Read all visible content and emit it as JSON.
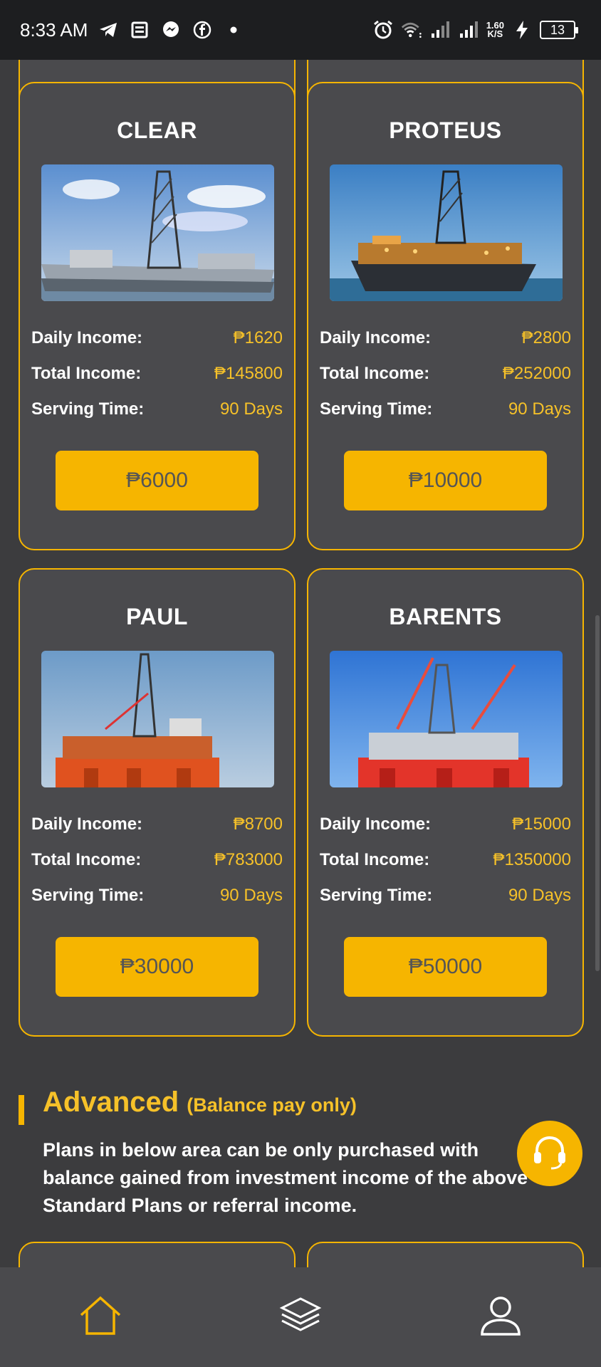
{
  "status_bar": {
    "time": "8:33 AM",
    "net_speed_value": "1.60",
    "net_speed_unit": "K/S",
    "battery": "13",
    "icons": [
      "telegram-icon",
      "news-icon",
      "messenger-icon",
      "facebook-icon",
      "dot-icon",
      "alarm-icon",
      "wifi-icon",
      "signal-icon",
      "signal-icon",
      "charging-icon"
    ]
  },
  "labels": {
    "daily_income": "Daily Income:",
    "total_income": "Total Income:",
    "serving_time": "Serving Time:"
  },
  "plans": [
    {
      "name": "CLEAR",
      "daily": "₱1620",
      "total": "₱145800",
      "time": "90 Days",
      "price": "₱6000"
    },
    {
      "name": "PROTEUS",
      "daily": "₱2800",
      "total": "₱252000",
      "time": "90 Days",
      "price": "₱10000"
    },
    {
      "name": "PAUL",
      "daily": "₱8700",
      "total": "₱783000",
      "time": "90 Days",
      "price": "₱30000"
    },
    {
      "name": "BARENTS",
      "daily": "₱15000",
      "total": "₱1350000",
      "time": "90 Days",
      "price": "₱50000"
    }
  ],
  "advanced": {
    "title": "Advanced",
    "subtitle": "(Balance pay only)",
    "description": "Plans in below area can be only purchased with balance gained from investment income of the above Standard Plans or referral income."
  },
  "bottom_nav": [
    "home-icon",
    "layers-icon",
    "user-icon"
  ],
  "colors": {
    "accent": "#f6b500",
    "background": "#3c3c3e",
    "card": "#4a4a4d"
  }
}
